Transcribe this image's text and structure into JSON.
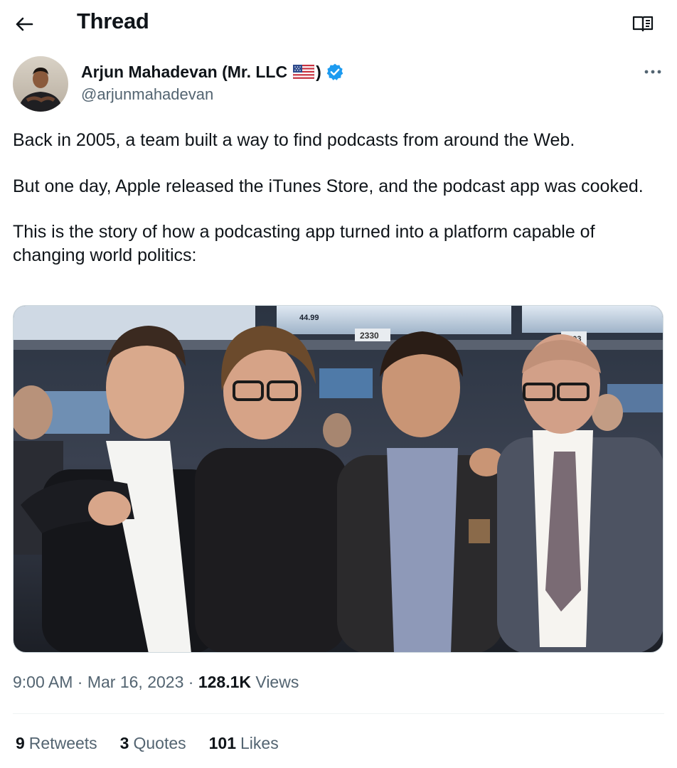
{
  "header": {
    "title": "Thread",
    "back_icon": "arrow-left-icon",
    "reader_icon": "open-book-icon"
  },
  "author": {
    "name": "Arjun Mahadevan (Mr. LLC",
    "name_close": ")",
    "flag_icon": "us-flag-icon",
    "verified_icon": "verified-badge-icon",
    "handle": "@arjunmahadevan"
  },
  "more_icon": "more-options-icon",
  "tweet": {
    "paragraphs": [
      "Back in 2005, a team built a way to find podcasts from around the Web.",
      "But one day, Apple released the iTunes Store, and the podcast app was cooked.",
      "This is the story of how a podcasting app turned into a platform capable of changing world politics:"
    ]
  },
  "media": {
    "signs": [
      "44.99",
      "2330",
      "1403"
    ]
  },
  "meta": {
    "time": "9:00 AM",
    "sep": "·",
    "date": "Mar 16, 2023",
    "views_count": "128.1K",
    "views_label": "Views"
  },
  "stats": {
    "retweets_count": "9",
    "retweets_label": "Retweets",
    "quotes_count": "3",
    "quotes_label": "Quotes",
    "likes_count": "101",
    "likes_label": "Likes"
  },
  "colors": {
    "text": "#0f1419",
    "secondary": "#536471",
    "accent": "#1d9bf0",
    "divider": "#eff3f4"
  }
}
